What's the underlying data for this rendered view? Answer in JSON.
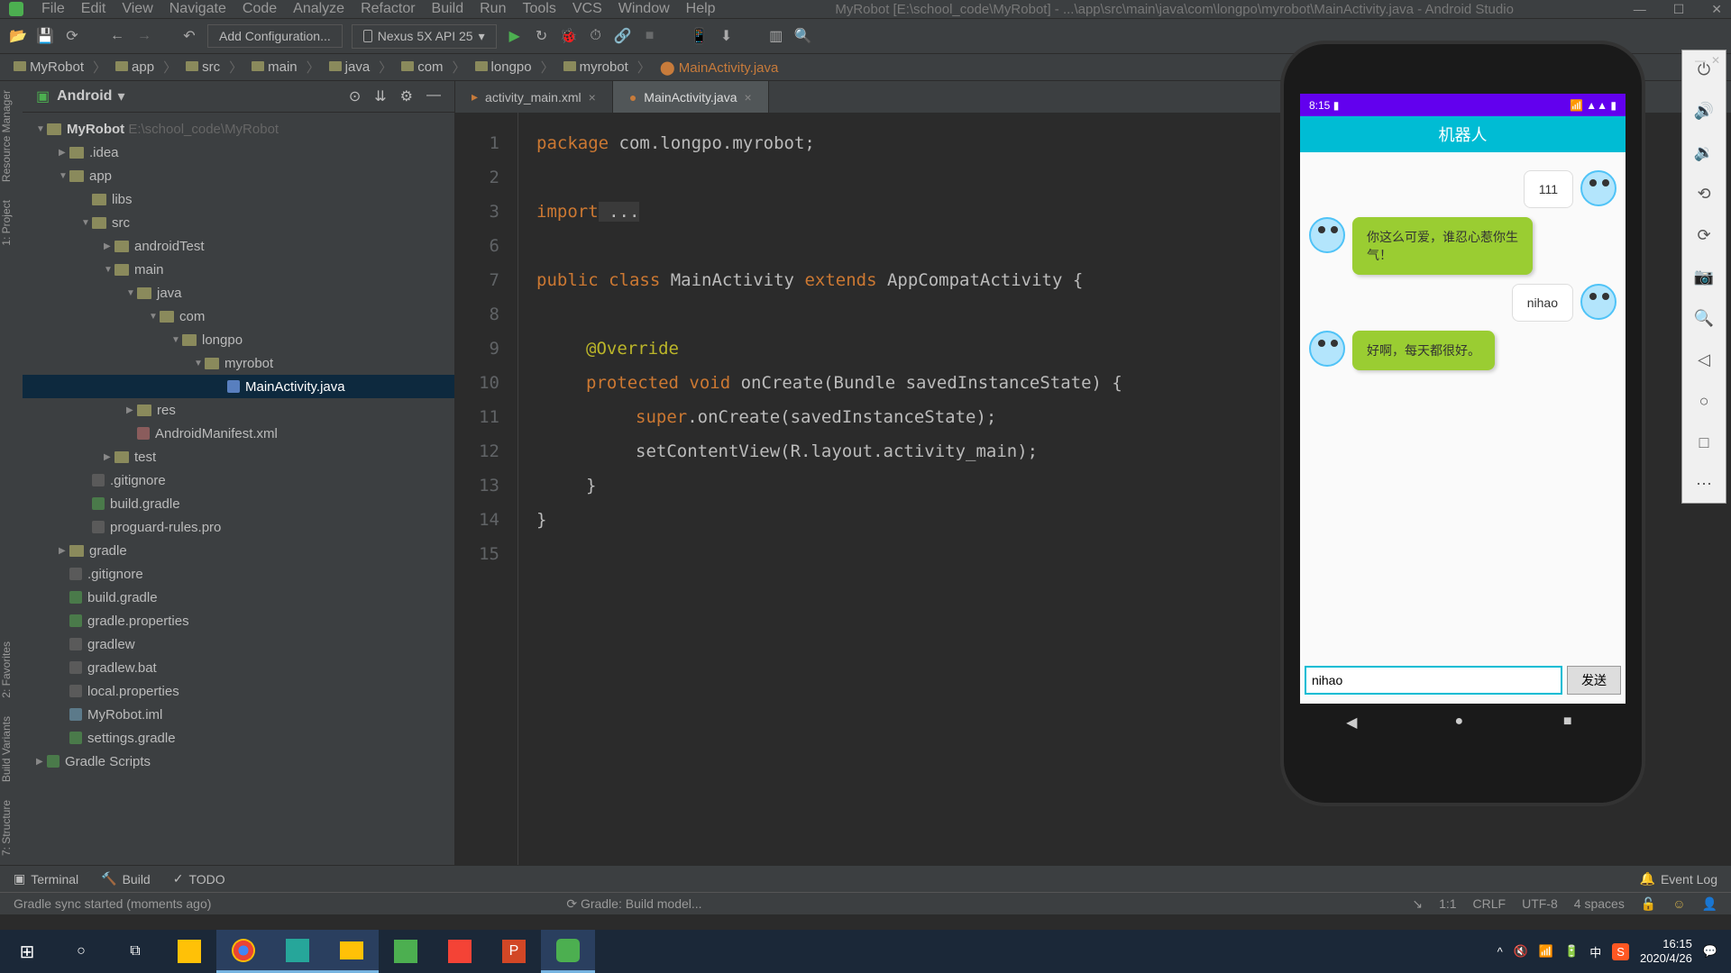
{
  "menu": {
    "file": "File",
    "edit": "Edit",
    "view": "View",
    "navigate": "Navigate",
    "code": "Code",
    "analyze": "Analyze",
    "refactor": "Refactor",
    "build": "Build",
    "run": "Run",
    "tools": "Tools",
    "vcs": "VCS",
    "window": "Window",
    "help": "Help"
  },
  "window_title": "MyRobot [E:\\school_code\\MyRobot] - ...\\app\\src\\main\\java\\com\\longpo\\myrobot\\MainActivity.java - Android Studio",
  "toolbar": {
    "config": "Add Configuration...",
    "device": "Nexus 5X API 25"
  },
  "breadcrumb": [
    "MyRobot",
    "app",
    "src",
    "main",
    "java",
    "com",
    "longpo",
    "myrobot",
    "MainActivity.java"
  ],
  "panel": {
    "mode": "Android",
    "root": "MyRobot",
    "root_path": "E:\\school_code\\MyRobot"
  },
  "tree": {
    "idea": ".idea",
    "app": "app",
    "libs": "libs",
    "src": "src",
    "androidTest": "androidTest",
    "main": "main",
    "java": "java",
    "com": "com",
    "longpo": "longpo",
    "myrobot": "myrobot",
    "mainactivity": "MainActivity.java",
    "res": "res",
    "manifest": "AndroidManifest.xml",
    "test": "test",
    "gitignore": ".gitignore",
    "buildgradle": "build.gradle",
    "proguard": "proguard-rules.pro",
    "gradle": "gradle",
    "gitignore2": ".gitignore",
    "buildgradle2": "build.gradle",
    "gradleprops": "gradle.properties",
    "gradlew": "gradlew",
    "gradlewbat": "gradlew.bat",
    "localprops": "local.properties",
    "iml": "MyRobot.iml",
    "settings": "settings.gradle",
    "scripts": "Gradle Scripts"
  },
  "tabs": {
    "t1": "activity_main.xml",
    "t2": "MainActivity.java"
  },
  "gutter": [
    "1",
    "2",
    "3",
    "6",
    "7",
    "8",
    "9",
    "10",
    "11",
    "12",
    "13",
    "14",
    "15"
  ],
  "code": {
    "l1_kw": "package",
    "l1_txt": " com.longpo.myrobot;",
    "l3_kw": "import",
    "l3_txt": " ...",
    "l7_kw1": "public ",
    "l7_kw2": "class ",
    "l7_cls": "MainActivity ",
    "l7_kw3": "extends ",
    "l7_ext": "AppCompatActivity {",
    "l9_ann": "@Override",
    "l10_kw1": "protected ",
    "l10_kw2": "void ",
    "l10_m": "onCreate(Bundle savedInstanceState) {",
    "l11_sup": "super",
    "l11_txt": ".onCreate(savedInstanceState);",
    "l12": "setContentView(R.layout.activity_main);",
    "l13": "}",
    "l14": "}"
  },
  "rail": {
    "rm": "Resource Manager",
    "proj": "1: Project",
    "fav": "2: Favorites",
    "bv": "Build Variants",
    "str": "7: Structure"
  },
  "bottom": {
    "terminal": "Terminal",
    "build": "Build",
    "todo": "TODO",
    "eventlog": "Event Log"
  },
  "status": {
    "msg": "Gradle sync started (moments ago)",
    "center": "Gradle: Build model...",
    "pos": "1:1",
    "crlf": "CRLF",
    "enc": "UTF-8",
    "spaces": "4 spaces"
  },
  "phone": {
    "time": "8:15",
    "title": "机器人",
    "msg1": "111",
    "msg2": "你这么可爱，谁忍心惹你生气！",
    "msg3": "nihao",
    "msg4": "好啊，每天都很好。",
    "input": "nihao",
    "send": "发送"
  },
  "taskbar": {
    "ime": "中",
    "sogou": "S",
    "time": "16:15",
    "date": "2020/4/26"
  }
}
